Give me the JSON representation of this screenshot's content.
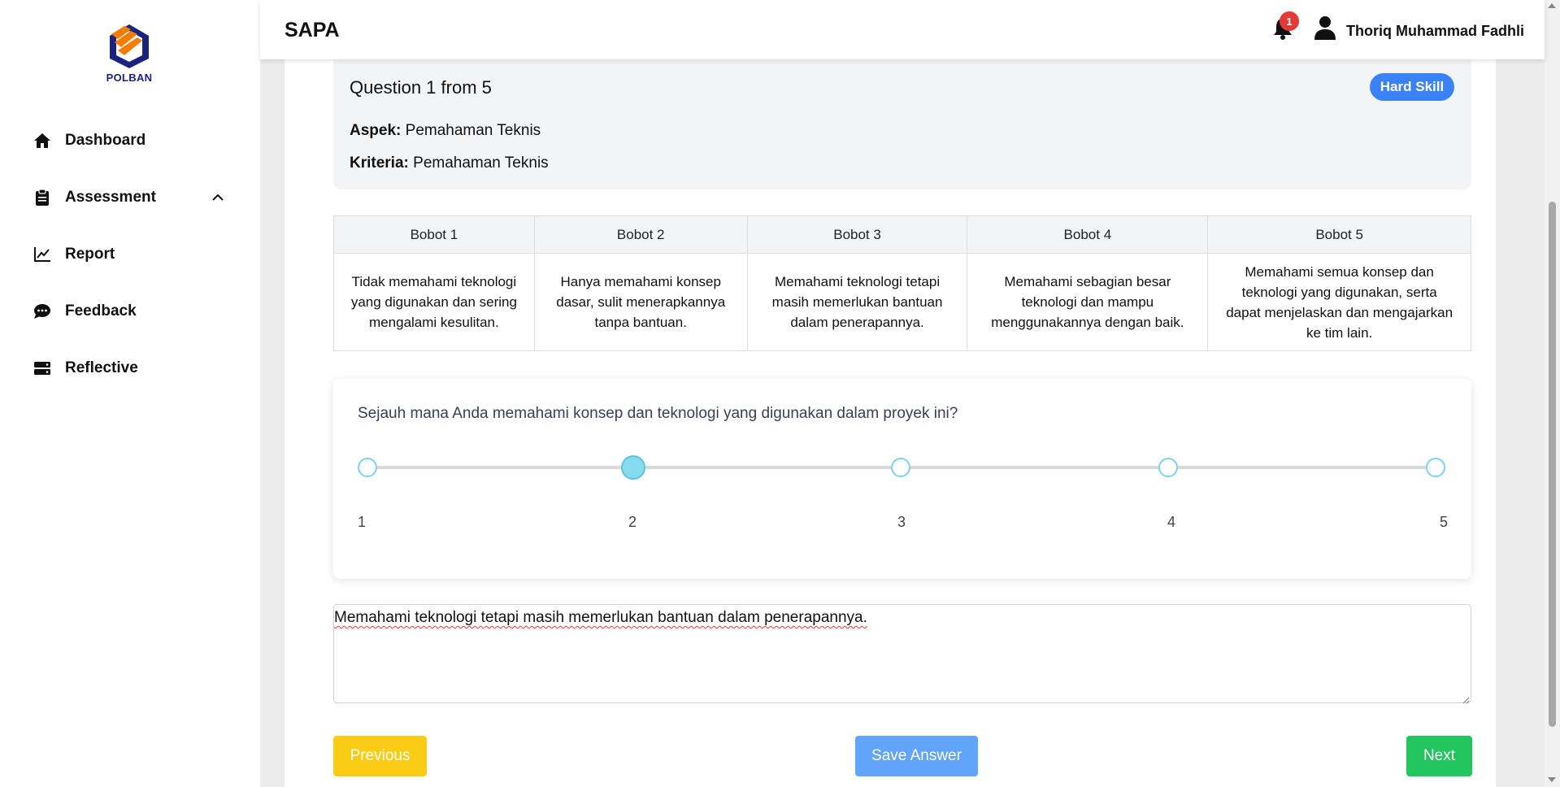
{
  "brand": {
    "logo_text": "POLBAN"
  },
  "sidebar": {
    "items": [
      {
        "label": "Dashboard",
        "icon": "home-icon"
      },
      {
        "label": "Assessment",
        "icon": "clipboard-icon",
        "expanded": true
      },
      {
        "label": "Report",
        "icon": "chart-line-icon"
      },
      {
        "label": "Feedback",
        "icon": "chat-bubble-icon"
      },
      {
        "label": "Reflective",
        "icon": "server-icon"
      }
    ]
  },
  "header": {
    "title": "SAPA",
    "notification_count": "1",
    "user_name": "Thoriq Muhammad Fadhli"
  },
  "question": {
    "title": "Question 1 from 5",
    "aspek_label": "Aspek:",
    "aspek_value": "Pemahaman Teknis",
    "kriteria_label": "Kriteria:",
    "kriteria_value": "Pemahaman Teknis",
    "badge": "Hard Skill"
  },
  "bobot": {
    "headers": [
      "Bobot 1",
      "Bobot 2",
      "Bobot 3",
      "Bobot 4",
      "Bobot 5"
    ],
    "descriptions": [
      "Tidak memahami teknologi yang digunakan dan sering mengalami kesulitan.",
      "Hanya memahami konsep dasar, sulit menerapkannya tanpa bantuan.",
      "Memahami teknologi tetapi masih memerlukan bantuan dalam penerapannya.",
      "Memahami sebagian besar teknologi dan mampu menggunakannya dengan baik.",
      "Memahami semua konsep dan teknologi yang digunakan, serta dapat menjelaskan dan mengajarkan ke tim lain."
    ]
  },
  "rating": {
    "question": "Sejauh mana Anda memahami konsep dan teknologi yang digunakan dalam proyek ini?",
    "labels": [
      "1",
      "2",
      "3",
      "4",
      "5"
    ],
    "selected": 2
  },
  "answer": {
    "value": "Memahami teknologi tetapi masih memerlukan bantuan dalam penerapannya."
  },
  "buttons": {
    "previous": "Previous",
    "save": "Save Answer",
    "next": "Next"
  },
  "colors": {
    "badge_blue": "#3b82f6",
    "previous_yellow": "#facc15",
    "save_blue": "#60a5fa",
    "next_green": "#22c55e",
    "notification_red": "#e53935",
    "slider_accent": "#86dbee"
  }
}
